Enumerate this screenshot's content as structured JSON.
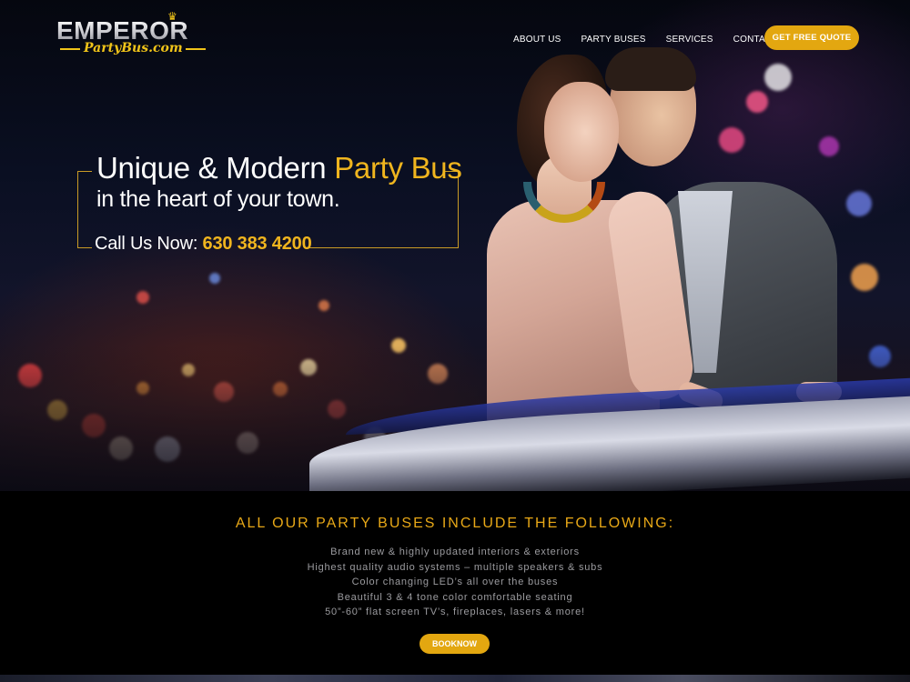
{
  "brand": {
    "top": "EMPEROR",
    "bottom": "PartyBus.com"
  },
  "nav": {
    "items": [
      "ABOUT US",
      "PARTY BUSES",
      "SERVICES",
      "CONTACT US"
    ],
    "cta": "GET FREE QUOTE"
  },
  "hero": {
    "headline_plain": "Unique & Modern ",
    "headline_accent": "Party Bus",
    "subhead": "in the heart of your town.",
    "call_label": "Call Us Now: ",
    "phone": "630 383 4200"
  },
  "features": {
    "title": "ALL OUR PARTY BUSES INCLUDE THE FOLLOWING:",
    "items": [
      "Brand new & highly updated interiors & exteriors",
      "Highest quality audio systems – multiple speakers & subs",
      "Color changing LED’s all over the buses",
      "Beautiful 3 & 4 tone color comfortable seating",
      "50”-60” flat screen TV’s, fireplaces, lasers & more!"
    ],
    "button": "BOOKNOW"
  },
  "colors": {
    "accent": "#e3a710",
    "gold_text": "#f0b51e",
    "background": "#000000"
  }
}
